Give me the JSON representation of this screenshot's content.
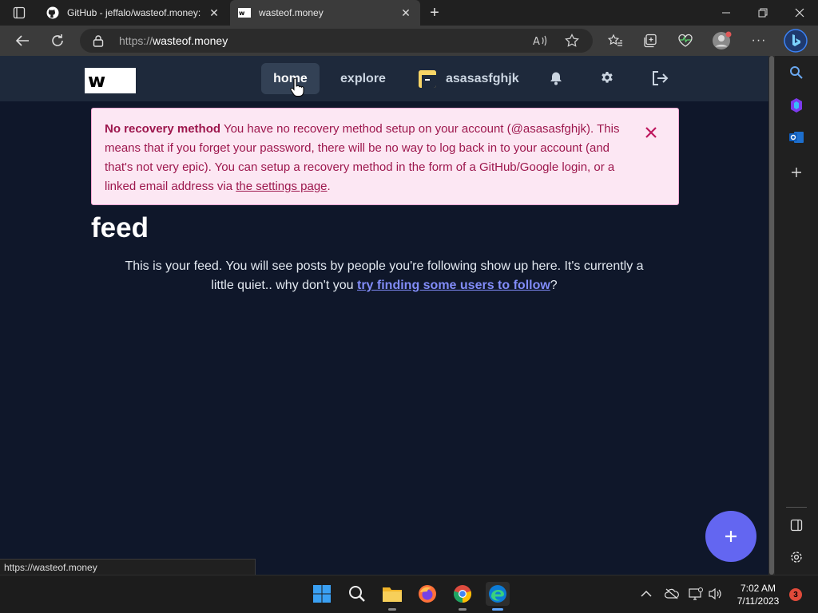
{
  "browser": {
    "tabs": [
      {
        "title": "GitHub - jeffalo/wasteof.money: ",
        "favicon": "github-icon",
        "active": false
      },
      {
        "title": "wasteof.money",
        "favicon": "wasteof-favicon",
        "active": true
      }
    ],
    "address": {
      "protocol": "https://",
      "host": "wasteof.money"
    },
    "status_url": "https://wasteof.money"
  },
  "site": {
    "logo": "w",
    "nav": {
      "home": "home",
      "explore": "explore",
      "username": "asasasfghjk"
    },
    "alert": {
      "title": "No recovery method",
      "text": "You have no recovery method setup on your account (@asasasfghjk). This means that if you forget your password, there will be no way to log back in to your account (and that's not very epic). You can setup a recovery method in the form of a GitHub/Google login, or a linked email address via",
      "link": "the settings page",
      "end": "."
    },
    "feed": {
      "title": "feed",
      "text": "This is your feed. You will see posts by people you're following show up here. It's currently a little quiet.. why don't you",
      "link": "try finding some users to follow",
      "end": "?"
    }
  },
  "taskbar": {
    "time": "7:02 AM",
    "date": "7/11/2023",
    "notifications": "3"
  },
  "colors": {
    "page_bg": "#0f172a",
    "nav_bg": "#1e293b",
    "alert_bg": "#fce7f3",
    "alert_text": "#9d174d",
    "accent": "#6366f1",
    "link": "#818cf8"
  }
}
